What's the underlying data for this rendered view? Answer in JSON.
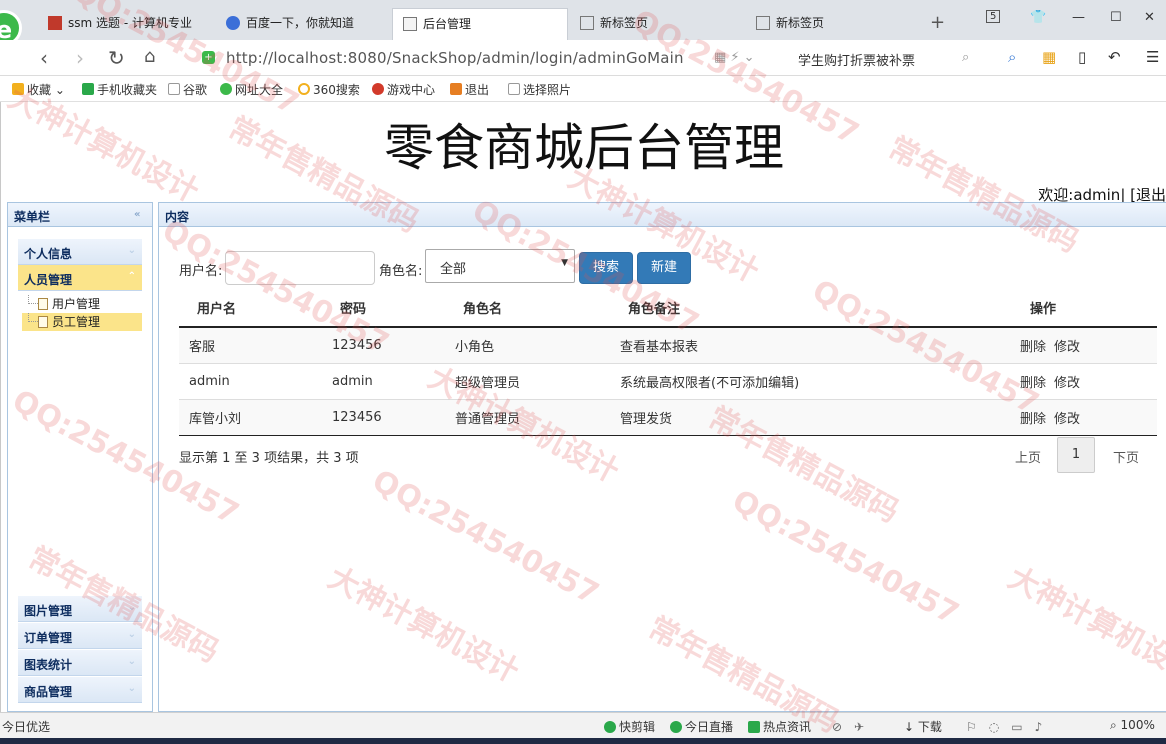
{
  "browser": {
    "tabs": [
      {
        "label": "ssm 选题 - 计算机专业",
        "active": false
      },
      {
        "label": "百度一下，你就知道",
        "active": false
      },
      {
        "label": "后台管理",
        "active": true
      },
      {
        "label": "新标签页",
        "active": false
      },
      {
        "label": "新标签页",
        "active": false
      }
    ],
    "tab_count": "5",
    "url": "http://localhost:8080/SnackShop/admin/login/adminGoMain",
    "search_text": "学生购打折票被补票",
    "favorites": [
      "收藏",
      "手机收藏夹",
      "谷歌",
      "网址大全",
      "360搜索",
      "游戏中心",
      "退出",
      "选择照片"
    ]
  },
  "page": {
    "title": "零食商城后台管理",
    "welcome": "欢迎:admin| [退出"
  },
  "sidebar": {
    "title": "菜单栏",
    "groups_top": [
      {
        "label": "个人信息",
        "selected": false
      },
      {
        "label": "人员管理",
        "selected": true
      }
    ],
    "tree_items": [
      {
        "label": "用户管理",
        "selected": false
      },
      {
        "label": "员工管理",
        "selected": true
      }
    ],
    "groups_bottom": [
      "图片管理",
      "订单管理",
      "图表统计",
      "商品管理"
    ]
  },
  "content": {
    "title": "内容",
    "filter": {
      "username_label": "用户名:",
      "username_value": "",
      "role_label": "角色名:",
      "role_selected": "全部",
      "search_label": "搜索",
      "new_label": "新建"
    },
    "table": {
      "headers": [
        "用户名",
        "密码",
        "角色名",
        "角色备注",
        "操作"
      ],
      "rows": [
        {
          "username": "客服",
          "password": "123456",
          "role": "小角色",
          "note": "查看基本报表"
        },
        {
          "username": "admin",
          "password": "admin",
          "role": "超级管理员",
          "note": "系统最高权限者(不可添加编辑)"
        },
        {
          "username": "库管小刘",
          "password": "123456",
          "role": "普通管理员",
          "note": "管理发货"
        }
      ],
      "delete_label": "删除",
      "edit_label": "修改"
    },
    "pagination": {
      "info": "显示第 1 至 3 项结果，共 3 项",
      "prev": "上页",
      "current": "1",
      "next": "下页"
    }
  },
  "statusbar": {
    "left": "今日优选",
    "items": [
      "快剪辑",
      "今日直播",
      "热点资讯",
      "下载"
    ],
    "zoom": "100%"
  },
  "watermark": {
    "texts": [
      "QQ:254540457",
      "常年售精品源码",
      "大神计算机设计"
    ]
  }
}
